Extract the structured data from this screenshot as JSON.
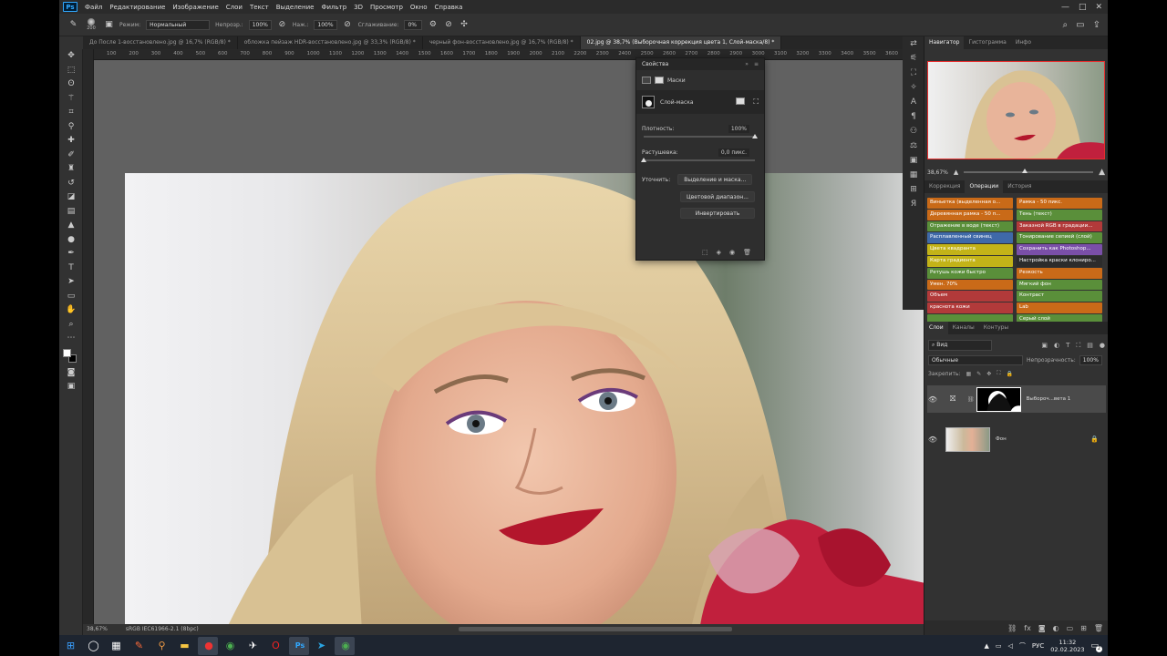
{
  "app": {
    "logo": "Ps"
  },
  "menu": [
    "Файл",
    "Редактирование",
    "Изображение",
    "Слои",
    "Текст",
    "Выделение",
    "Фильтр",
    "3D",
    "Просмотр",
    "Окно",
    "Справка"
  ],
  "window_controls": [
    "—",
    "□",
    "✕"
  ],
  "options": {
    "brush_size": "200",
    "mode_label": "Режим:",
    "mode_value": "Нормальный",
    "opacity_label": "Непрозр.:",
    "opacity_value": "100%",
    "flow_label": "Наж.:",
    "flow_value": "100%",
    "smoothing_label": "Сглаживание:",
    "smoothing_value": "0%"
  },
  "tabs": [
    {
      "label": "До После 1-восстановлено.jpg @ 16,7% (RGB/8) *",
      "active": false
    },
    {
      "label": "обложка пейзаж HDR-восстановлено.jpg @ 33,3% (RGB/8) *",
      "active": false
    },
    {
      "label": "черный фон-восстановлено.jpg @ 16,7% (RGB/8) *",
      "active": false
    },
    {
      "label": "02.jpg @ 38,7% (Выборочная коррекция цвета 1, Слой-маска/8) *",
      "active": true
    }
  ],
  "ruler_ticks": [
    "100",
    "200",
    "300",
    "400",
    "500",
    "600",
    "700",
    "800",
    "900",
    "1000",
    "1100",
    "1200",
    "1300",
    "1400",
    "1500",
    "1600",
    "1700",
    "1800",
    "1900",
    "2000",
    "2100",
    "2200",
    "2300",
    "2400",
    "2500",
    "2600",
    "2700",
    "2800",
    "2900",
    "3000",
    "3100",
    "3200",
    "3300",
    "3400",
    "3500",
    "3600",
    "3700"
  ],
  "status": {
    "zoom": "38,67%",
    "profile": "sRGB IEC61966-2.1 (8bpc)"
  },
  "properties": {
    "title": "Свойства",
    "masks_label": "Маски",
    "layer_mask_label": "Слой-маска",
    "density_label": "Плотность:",
    "density_value": "100%",
    "density_level": 1.0,
    "feather_label": "Растушевка:",
    "feather_value": "0,0 пикс.",
    "feather_level": 0.0,
    "refine_label": "Уточнить:",
    "btn_select_mask": "Выделение и маска...",
    "btn_color_range": "Цветовой диапазон...",
    "btn_invert": "Инвертировать"
  },
  "navigator": {
    "tabs": [
      "Навигатор",
      "Гистограмма",
      "Инфо"
    ],
    "zoom": "38,67%"
  },
  "actions": {
    "tabs": [
      "Коррекция",
      "Операции",
      "История"
    ],
    "items": [
      {
        "label": "Виньетка (выделенная о...",
        "color": "#c96a18"
      },
      {
        "label": "Рамка - 50 пикс.",
        "color": "#c96a18"
      },
      {
        "label": "Деревянная рамка - 50 п...",
        "color": "#c96a18"
      },
      {
        "label": "Тень (текст)",
        "color": "#5a8f3a"
      },
      {
        "label": "Отражение в воде (текст)",
        "color": "#5a8f3a"
      },
      {
        "label": "Заказной RGB в градации...",
        "color": "#b23a3a"
      },
      {
        "label": "Расплавленный свинец",
        "color": "#3f69a8"
      },
      {
        "label": "Тонирование сепией (слой)",
        "color": "#5a8f3a"
      },
      {
        "label": "Цвета квадранта",
        "color": "#c3b318"
      },
      {
        "label": "Сохранить как Photoshop...",
        "color": "#7a4fa8"
      },
      {
        "label": "Карта градиента",
        "color": "#c3b318"
      },
      {
        "label": "Настройка краски клониро...",
        "color": "#2c2c2c"
      },
      {
        "label": "Ретушь кожи быстро",
        "color": "#5a8f3a"
      },
      {
        "label": "Резкость",
        "color": "#c96a18"
      },
      {
        "label": "Умен. 70%",
        "color": "#c96a18"
      },
      {
        "label": "Мягкий фон",
        "color": "#5a8f3a"
      },
      {
        "label": "Объем",
        "color": "#b23a3a"
      },
      {
        "label": "Контраст",
        "color": "#5a8f3a"
      },
      {
        "label": "краснота кожи",
        "color": "#b23a3a"
      },
      {
        "label": "Lab",
        "color": "#c96a18"
      },
      {
        "label": "",
        "color": "#5a8f3a"
      },
      {
        "label": "Серый слой",
        "color": "#5a8f3a"
      }
    ]
  },
  "layers": {
    "tabs": [
      "Слои",
      "Каналы",
      "Контуры"
    ],
    "filter_label": "Вид",
    "blend_mode": "Обычные",
    "opacity_label": "Непрозрачность:",
    "opacity_value": "100%",
    "lock_label": "Закрепить:",
    "items": [
      {
        "name": "Выбороч...вета 1"
      },
      {
        "name": "Фон"
      }
    ]
  },
  "taskbar": {
    "lang": "РУС",
    "time": "11:32",
    "date": "02.02.2023",
    "notif": "2"
  }
}
